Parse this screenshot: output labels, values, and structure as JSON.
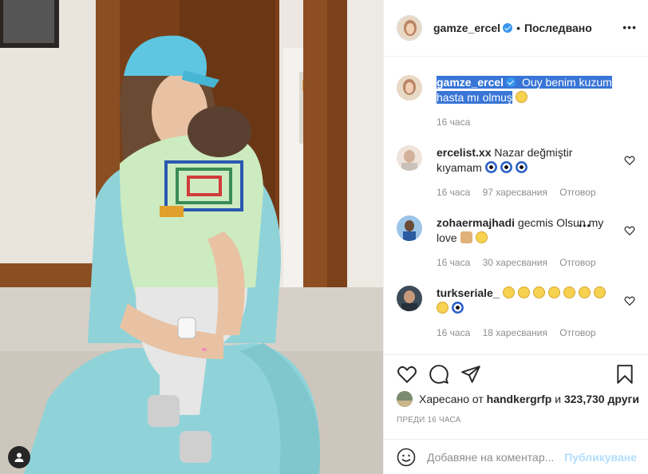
{
  "header": {
    "username": "gamze_ercel",
    "separator": "•",
    "follow_status": "Последвано",
    "more_label": "•••"
  },
  "caption": {
    "username": "gamze_ercel",
    "text": "Ouy benim kuzum hasta mı olmuş",
    "emoji_name": "sad-face-emoji",
    "time": "16 часа"
  },
  "comments": [
    {
      "username": "ercelist.xx",
      "text": "Nazar değmiştir kıyamam",
      "emojis": [
        "nazar-emoji",
        "nazar-emoji",
        "nazar-emoji"
      ],
      "time": "16 часа",
      "likes": "97 харесвания",
      "reply": "Отговор"
    },
    {
      "username": "zohaermajhadi",
      "text": "gecmis Olsun my love",
      "emojis": [
        "praying-hands-emoji",
        "crying-face-emoji"
      ],
      "time": "16 часа",
      "likes": "30 харесвания",
      "reply": "Отговор"
    },
    {
      "username": "turkseriale_",
      "text": "",
      "emojis": [
        "smiling-face-emoji",
        "smiling-face-emoji",
        "smiling-face-emoji",
        "smiling-face-emoji",
        "heart-eyes-emoji",
        "heart-eyes-emoji",
        "heart-eyes-emoji",
        "heart-eyes-emoji",
        "nazar-emoji"
      ],
      "time": "16 часа",
      "likes": "18 харесвания",
      "reply": "Отговор"
    }
  ],
  "likes": {
    "prefix": "Харесано от",
    "user": "handkergrfp",
    "joiner": "и",
    "count": "323,730 други"
  },
  "date": "ПРЕДИ 16 ЧАСА",
  "add_comment": {
    "placeholder": "Добавяне на коментар...",
    "post_label": "Публикуване"
  },
  "colors": {
    "verified": "#3897f0",
    "selection": "#3875d7",
    "publish_disabled": "#b2dffc",
    "muted_text": "#8e8e8e"
  }
}
